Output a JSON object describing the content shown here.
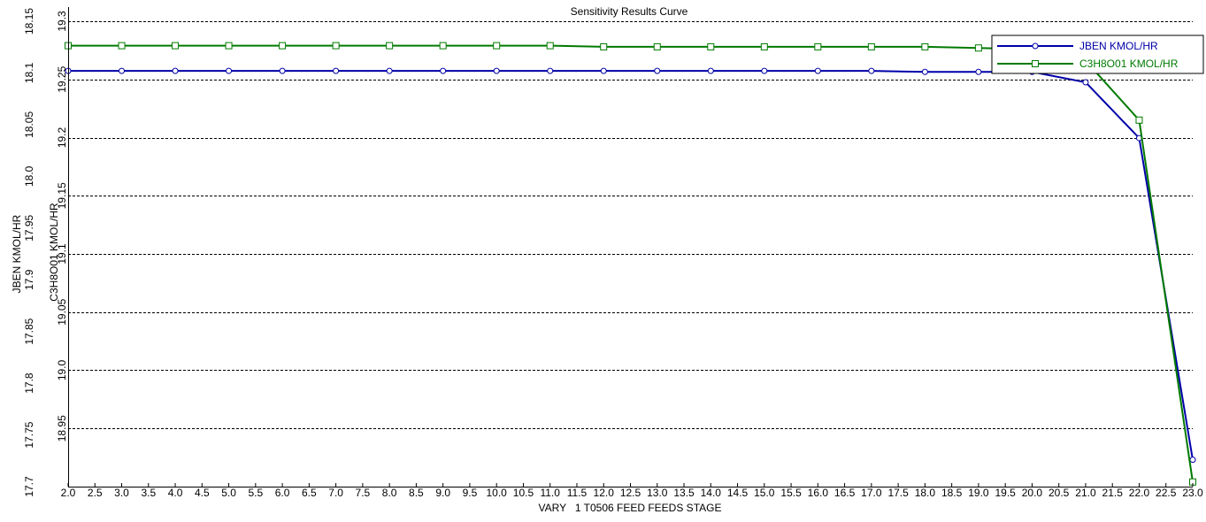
{
  "chart_data": {
    "type": "line",
    "title": "Sensitivity Results Curve",
    "xlabel": "VARY   1 T0506 FEED FEEDS STAGE",
    "ylabel_left": "JBEN KMOL/HR",
    "ylabel_right": "C3H8O01 KMOL/HR",
    "x": [
      2,
      3,
      4,
      5,
      6,
      7,
      8,
      9,
      10,
      11,
      12,
      13,
      14,
      15,
      16,
      17,
      18,
      19,
      20,
      21,
      22,
      23
    ],
    "x_ticks": [
      "2.0",
      "2.5",
      "3.0",
      "3.5",
      "4.0",
      "4.5",
      "5.0",
      "5.5",
      "6.0",
      "6.5",
      "7.0",
      "7.5",
      "8.0",
      "8.5",
      "9.0",
      "9.5",
      "10.0",
      "10.5",
      "11.0",
      "11.5",
      "12.0",
      "12.5",
      "13.0",
      "13.5",
      "14.0",
      "14.5",
      "15.0",
      "15.5",
      "16.0",
      "16.5",
      "17.0",
      "17.5",
      "18.0",
      "18.5",
      "19.0",
      "19.5",
      "20.0",
      "20.5",
      "21.0",
      "21.5",
      "22.0",
      "22.5",
      "23.0"
    ],
    "xlim": [
      2,
      23
    ],
    "y1_ticks": [
      "17.7",
      "17.75",
      "17.8",
      "17.85",
      "17.9",
      "17.95",
      "18.0",
      "18.05",
      "18.1",
      "18.15"
    ],
    "y1lim": [
      17.7,
      18.15
    ],
    "y2_ticks": [
      "18.95",
      "19.0",
      "19.05",
      "19.1",
      "19.15",
      "19.2",
      "19.25",
      "19.3"
    ],
    "y2lim": [
      18.9,
      19.3
    ],
    "grid": "horizontal dashed",
    "legend_position": "top-right",
    "series": [
      {
        "name": "JBEN KMOL/HR",
        "axis": "left",
        "color": "#0000a8",
        "marker": "circle",
        "values": [
          18.102,
          18.102,
          18.102,
          18.102,
          18.102,
          18.102,
          18.102,
          18.102,
          18.102,
          18.102,
          18.102,
          18.102,
          18.102,
          18.102,
          18.102,
          18.102,
          18.101,
          18.101,
          18.101,
          18.091,
          18.037,
          17.726
        ]
      },
      {
        "name": "C3H8O01 KMOL/HR",
        "axis": "right",
        "color": "#007a00",
        "marker": "square",
        "values": [
          19.279,
          19.279,
          19.279,
          19.279,
          19.279,
          19.279,
          19.279,
          19.279,
          19.279,
          19.279,
          19.278,
          19.278,
          19.278,
          19.278,
          19.278,
          19.278,
          19.278,
          19.277,
          19.276,
          19.266,
          19.215,
          18.904
        ]
      }
    ]
  }
}
